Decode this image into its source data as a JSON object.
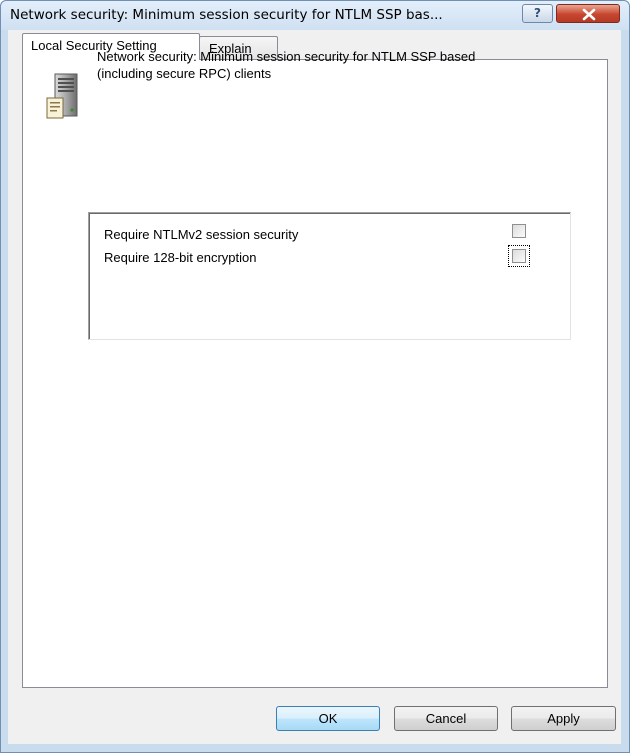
{
  "window": {
    "title": "Network security: Minimum session security for NTLM SSP bas...",
    "help_glyph": "?",
    "close_icon": "close-x-icon"
  },
  "tabs": [
    {
      "label": "Local Security Setting",
      "selected": true
    },
    {
      "label": "Explain",
      "selected": false
    }
  ],
  "policy": {
    "icon": "server-policy-icon",
    "description_line1": "Network security: Minimum session security for NTLM SSP based",
    "description_line2": "(including secure RPC) clients"
  },
  "options": [
    {
      "label": "Require NTLMv2 session security",
      "checked": false
    },
    {
      "label": "Require 128-bit encryption",
      "checked": false,
      "focused": true
    }
  ],
  "buttons": {
    "ok": "OK",
    "cancel": "Cancel",
    "apply": "Apply"
  },
  "colors": {
    "frame": "#c9dcee",
    "client": "#f0f0f0",
    "close_button": "#c8462f"
  }
}
